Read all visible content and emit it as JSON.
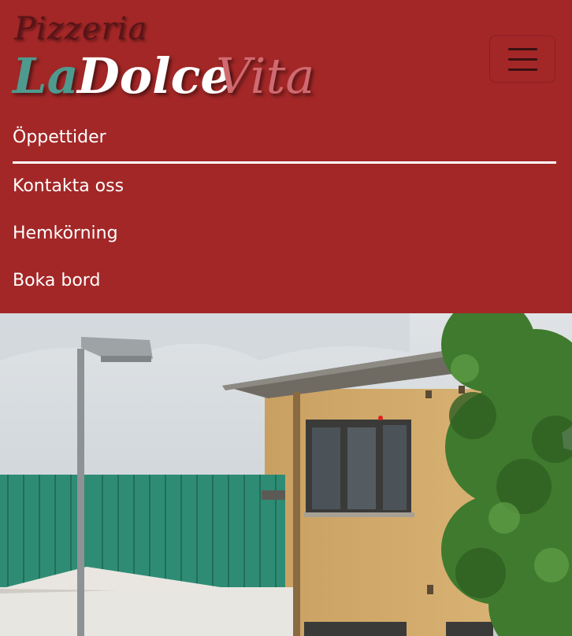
{
  "brand": {
    "line1": "Pizzeria",
    "line2_part1": "La",
    "line2_part2": "Dolce",
    "line2_part3": "Vita"
  },
  "menu_toggle": {
    "icon": "hamburger-menu-icon"
  },
  "nav": {
    "items": [
      {
        "label": "Öppettider",
        "active": true
      },
      {
        "label": "Kontakta oss",
        "active": false
      },
      {
        "label": "Hemkörning",
        "active": false
      },
      {
        "label": "Boka bord",
        "active": false
      }
    ]
  },
  "colors": {
    "header_bg": "#a32727",
    "nav_text": "#ffffff",
    "logo_teal": "#4f9a8e",
    "logo_pink": "#d06a70"
  }
}
